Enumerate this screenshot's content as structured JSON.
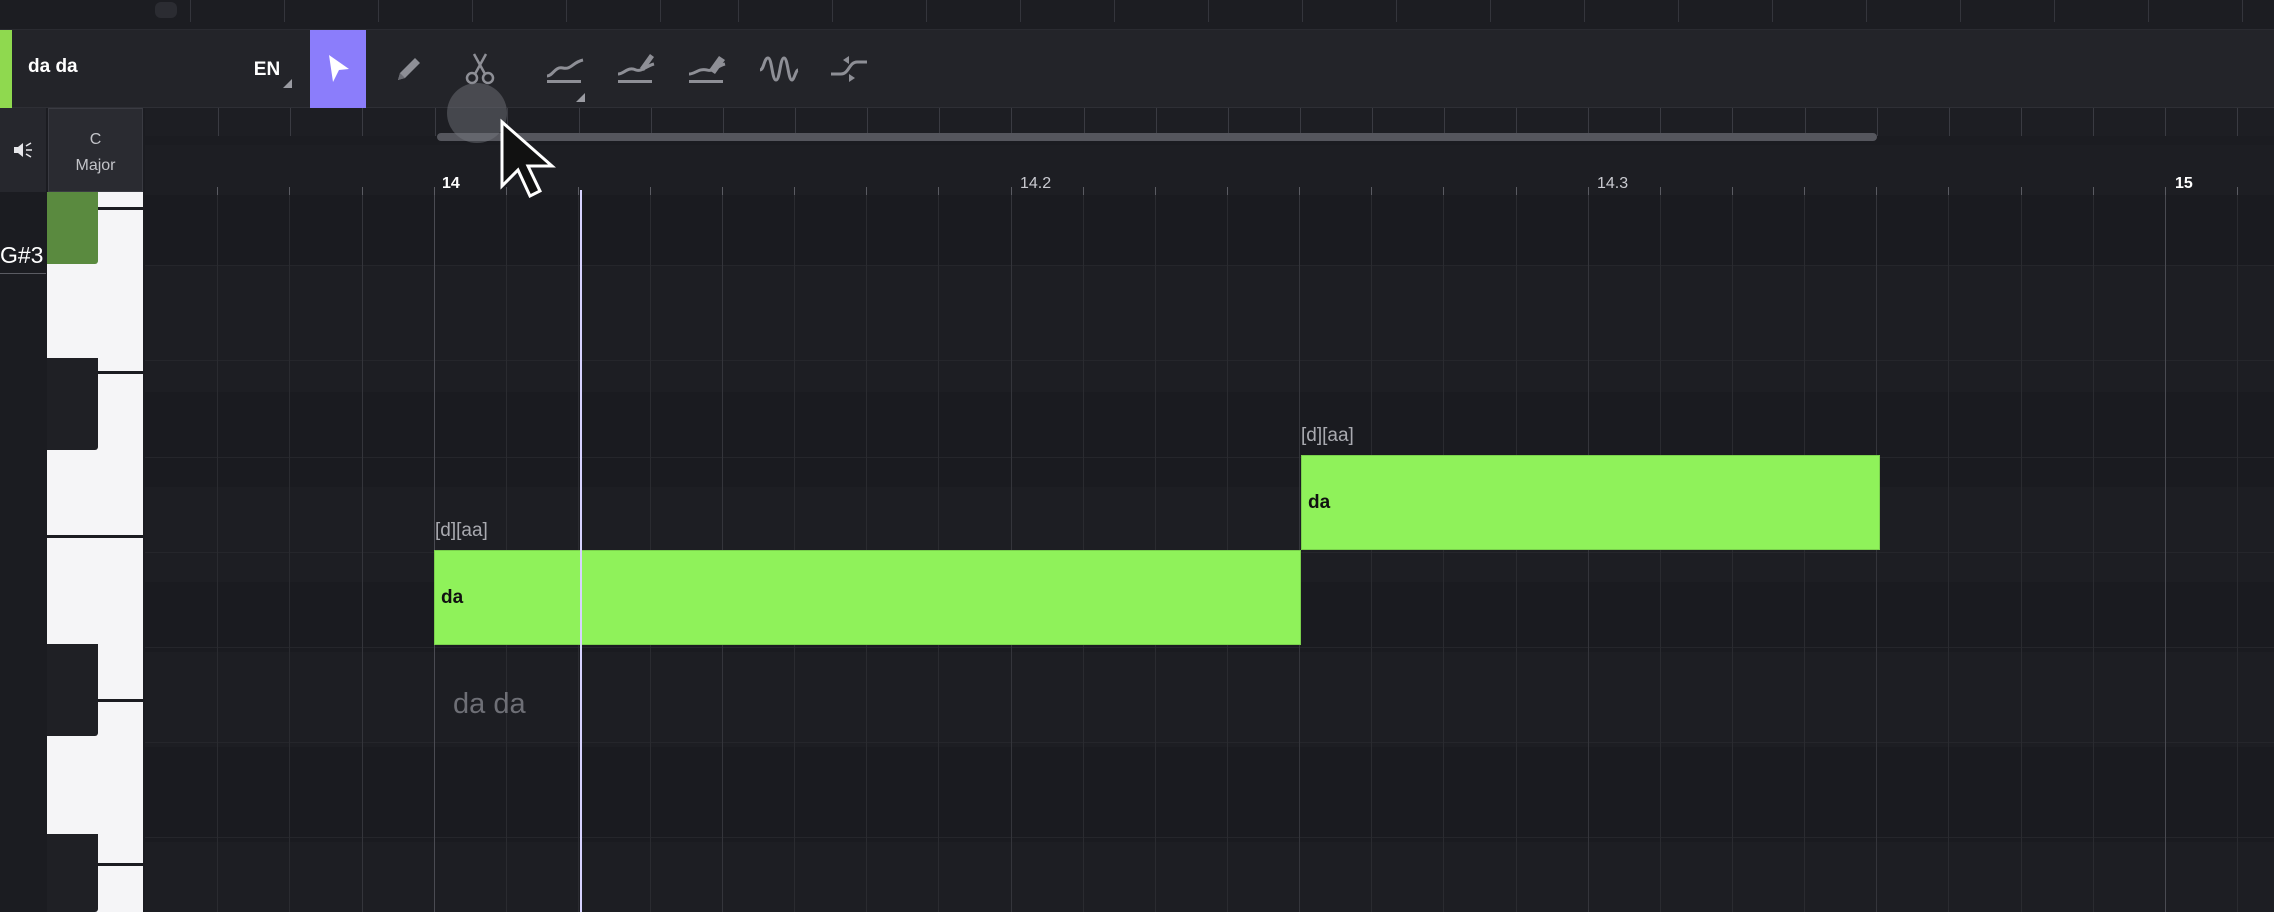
{
  "track": {
    "name": "da da",
    "color": "#8fd94f"
  },
  "toolbar": {
    "language": "EN",
    "tools": [
      {
        "id": "select",
        "icon": "pointer-arrow-icon",
        "active": true
      },
      {
        "id": "pencil",
        "icon": "pencil-icon"
      },
      {
        "id": "cut",
        "icon": "scissors-icon"
      },
      {
        "id": "pitch-draw",
        "icon": "pitch-draw-icon"
      },
      {
        "id": "pitch-edit",
        "icon": "pitch-edit-icon"
      },
      {
        "id": "pitch-smooth",
        "icon": "pitch-smooth-icon"
      },
      {
        "id": "vibrato",
        "icon": "vibrato-wave-icon"
      },
      {
        "id": "transition",
        "icon": "transition-curve-icon"
      }
    ],
    "active_color": "#8b7dfb"
  },
  "key": {
    "tonic": "C",
    "mode": "Major"
  },
  "piano": {
    "highlighted_pitch": "G#3"
  },
  "ruler": {
    "labels": [
      "14",
      "14.2",
      "14.3",
      "15"
    ]
  },
  "notes": [
    {
      "lyric": "da",
      "phonemes": "[d][aa]"
    },
    {
      "lyric": "da",
      "phonemes": "[d][aa]"
    }
  ],
  "lyric_hint": "da da",
  "note_color": "#8ff25a"
}
